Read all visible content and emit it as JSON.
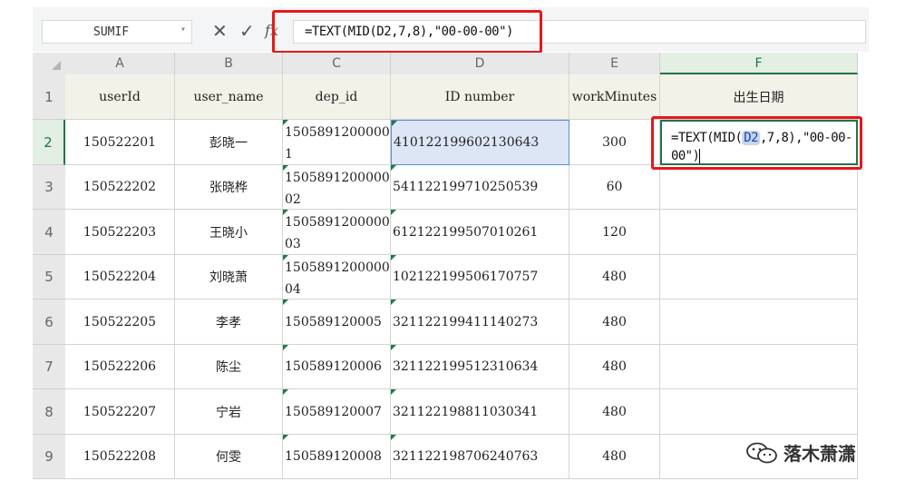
{
  "formula_bar": {
    "name_box": "SUMIF",
    "cancel_glyph": "✕",
    "confirm_glyph": "✓",
    "fx_label": "fx",
    "formula": "=TEXT(MID(D2,7,8),\"00-00-00\")"
  },
  "columns": [
    "A",
    "B",
    "C",
    "D",
    "E",
    "F"
  ],
  "active_column": "F",
  "rows": [
    "1",
    "2",
    "3",
    "4",
    "5",
    "6",
    "7",
    "8",
    "9"
  ],
  "active_row": "2",
  "headers": {
    "userId": "userId",
    "user_name": "user_name",
    "dep_id": "dep_id",
    "id_number": "ID number",
    "workMinutes": "workMinutes",
    "birth_date": "出生日期"
  },
  "data_rows": [
    {
      "userId": "150522201",
      "user_name": "彭晓一",
      "dep_id": "15058912000001",
      "id_number": "410122199602130643",
      "workMinutes": "300"
    },
    {
      "userId": "150522202",
      "user_name": "张晓桦",
      "dep_id": "150589120000002",
      "id_number": "541122199710250539",
      "workMinutes": "60"
    },
    {
      "userId": "150522203",
      "user_name": "王晓小",
      "dep_id": "150589120000003",
      "id_number": "612122199507010261",
      "workMinutes": "120"
    },
    {
      "userId": "150522204",
      "user_name": "刘晓萧",
      "dep_id": "150589120000004",
      "id_number": "102122199506170757",
      "workMinutes": "480"
    },
    {
      "userId": "150522205",
      "user_name": "李孝",
      "dep_id": "150589120005",
      "id_number": "321122199411140273",
      "workMinutes": "480"
    },
    {
      "userId": "150522206",
      "user_name": "陈尘",
      "dep_id": "150589120006",
      "id_number": "321122199512310634",
      "workMinutes": "480"
    },
    {
      "userId": "150522207",
      "user_name": "宁岩",
      "dep_id": "150589120007",
      "id_number": "321122198811030341",
      "workMinutes": "480"
    },
    {
      "userId": "150522208",
      "user_name": "何雯",
      "dep_id": "150589120008",
      "id_number": "321122198706240763",
      "workMinutes": "480"
    }
  ],
  "editing_cell": {
    "pre": "=TEXT(MID(",
    "ref": "D2",
    "post": ",7,8),\"00-00-00\")"
  },
  "watermark": "落木萧潇",
  "colors": {
    "highlight_red": "#e5181b",
    "active_green": "#217346",
    "header_fill": "#f3f2e9",
    "selection_fill": "#dde6f5"
  }
}
